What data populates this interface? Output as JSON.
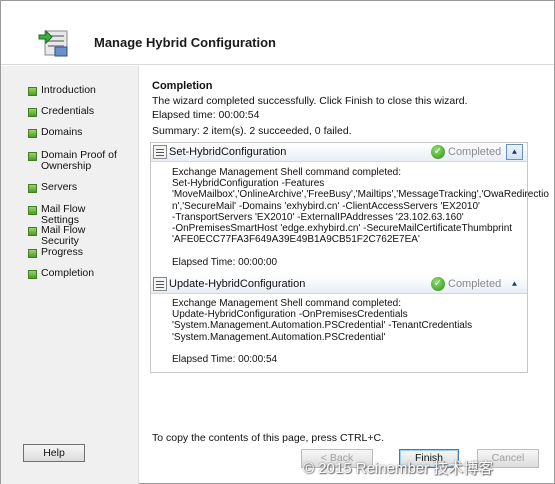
{
  "window": {
    "title": "Manage Hybrid Configuration"
  },
  "sidebar": {
    "items": [
      {
        "label": "Introduction"
      },
      {
        "label": "Credentials"
      },
      {
        "label": "Domains"
      },
      {
        "label": "Domain Proof of Ownership"
      },
      {
        "label": "Servers"
      },
      {
        "label": "Mail Flow Settings"
      },
      {
        "label": "Mail Flow Security"
      },
      {
        "label": "Progress"
      },
      {
        "label": "Completion"
      }
    ],
    "help_label": "Help"
  },
  "main": {
    "section_title": "Completion",
    "message": "The wizard completed successfully. Click Finish to close this wizard.",
    "elapsed": "Elapsed time: 00:00:54",
    "summary": "Summary: 2 item(s). 2 succeeded, 0 failed.",
    "tasks": [
      {
        "name": "Set-HybridConfiguration",
        "status": "Completed",
        "body": "Exchange Management Shell command completed:\nSet-HybridConfiguration -Features\n'MoveMailbox','OnlineArchive','FreeBusy','Mailtips','MessageTracking','OwaRedirectio\nn','SecureMail' -Domains 'exhybird.cn' -ClientAccessServers 'EX2010'\n-TransportServers 'EX2010' -ExternalIPAddresses '23.102.63.160'\n-OnPremisesSmartHost 'edge.exhybird.cn' -SecureMailCertificateThumbprint\n'AFE0ECC77FA3F649A39E49B1A9CB51F2C762E7EA'\n\nElapsed Time: 00:00:00"
      },
      {
        "name": "Update-HybridConfiguration",
        "status": "Completed",
        "body": "Exchange Management Shell command completed:\nUpdate-HybridConfiguration -OnPremisesCredentials\n'System.Management.Automation.PSCredential' -TenantCredentials\n'System.Management.Automation.PSCredential'\n\nElapsed Time: 00:00:54"
      }
    ],
    "copy_hint": "To copy the contents of this page, press CTRL+C."
  },
  "footer": {
    "back_label": "< Back",
    "finish_label": "Finish",
    "cancel_label": "Cancel"
  },
  "watermark": "© 2015 Reinember 技术博客",
  "colors": {
    "accent_green": "#4e9a2a",
    "status_gray": "#8a8a8a"
  }
}
